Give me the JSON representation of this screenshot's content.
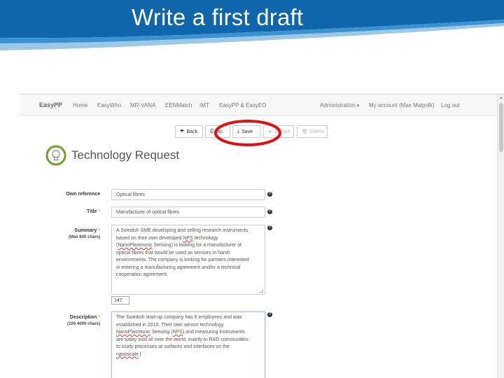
{
  "slide": {
    "title": "Write a first draft"
  },
  "navbar": {
    "brand": "EasyPP",
    "items": [
      "Home",
      "EasyWho",
      "MR-VANA",
      "EENMatch",
      "IMT",
      "EasyPP & EasyEO"
    ],
    "right": [
      "Administration",
      "My account (Max Malpolk)",
      "Log out"
    ]
  },
  "toolbar": {
    "back": "Back",
    "print": "Inc",
    "save": "Save",
    "submit": "Submit",
    "delete": "Delete"
  },
  "page": {
    "heading": "Technology Request"
  },
  "form": {
    "own_reference": {
      "label": "Own reference",
      "value": "Optical fibres"
    },
    "title": {
      "label": "Title",
      "required": "*",
      "value": "Manufacturer of optical fibres"
    },
    "summary": {
      "label": "Summary",
      "required": "*",
      "sublabel": "(Max 600 chars)",
      "lines": [
        "A Swedish SME developing and selling research instruments",
        "based on their own developed ",
        "NanoPlasmonic",
        " Sensing) is looking for a manufacturer of",
        "optical fibres that would be used as sensors in harsh",
        "environments. The company is looking for partners interested",
        "in entering a manufacturing agreement and/or a technical",
        "cooperation agreement."
      ],
      "nps": "NPS",
      "tech_word": "technology",
      "paren": "(",
      "count": "147"
    },
    "description": {
      "label": "Description",
      "required": "*",
      "sublabel": "(100-4000 chars)",
      "lines": [
        "The Swedish start-up company has 6 employees and was",
        "established in 2010. Their own sensor technology",
        "NanoPlasmonic",
        " Sensing (",
        "NPS",
        ") and measuring instruments",
        "are today sold all over the world, mainly to R&D communities",
        "to study processes at surfaces and interfaces on the",
        "nanoscale"
      ]
    }
  },
  "colors": {
    "slide_blue": "#1a6fb0",
    "highlight_red": "#e01010"
  }
}
